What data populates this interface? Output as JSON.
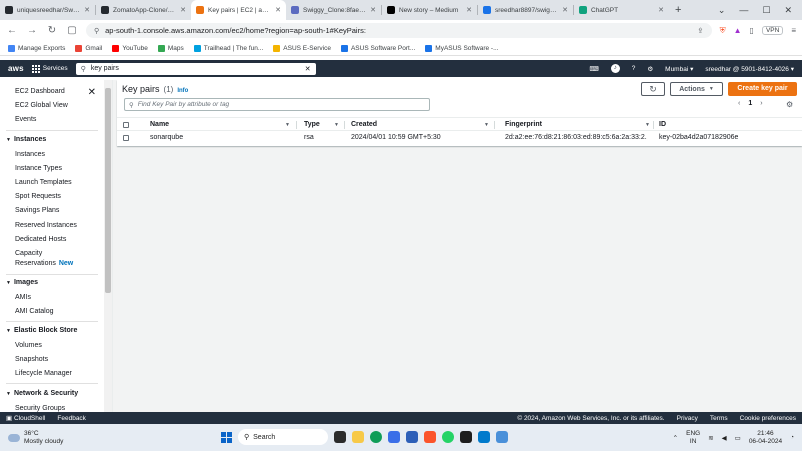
{
  "browser": {
    "tabs": [
      {
        "label": "uniquesreedhar/Swiggy_...",
        "color": "#24292f",
        "active": false
      },
      {
        "label": "ZomatoApp-Clone/Githu...",
        "color": "#24292f",
        "active": false
      },
      {
        "label": "Key pairs | EC2 | ap-s...",
        "color": "#ec7211",
        "active": true
      },
      {
        "label": "Swiggy_Clone:8fae6ef6-...",
        "color": "#5c6bc0",
        "active": false
      },
      {
        "label": "New story – Medium",
        "color": "#000000",
        "active": false
      },
      {
        "label": "sreedhar8897/swiggy Ta...",
        "color": "#1a73e8",
        "active": false
      },
      {
        "label": "ChatGPT",
        "color": "#10a37f",
        "active": false
      }
    ],
    "url": "ap-south-1.console.aws.amazon.com/ec2/home?region=ap-south-1#KeyPairs:",
    "vpn_label": "VPN",
    "bookmarks": [
      {
        "label": "Manage Exports",
        "color": "#4285f4"
      },
      {
        "label": "Gmail",
        "color": "#ea4335"
      },
      {
        "label": "YouTube",
        "color": "#ff0000"
      },
      {
        "label": "Maps",
        "color": "#34a853"
      },
      {
        "label": "Trailhead | The fun...",
        "color": "#00a1e0"
      },
      {
        "label": "ASUS E-Service",
        "color": "#f4b400"
      },
      {
        "label": "ASUS Software Port...",
        "color": "#1a73e8"
      },
      {
        "label": "MyASUS Software -...",
        "color": "#1a73e8"
      }
    ]
  },
  "aws_nav": {
    "logo": "aws",
    "services_label": "Services",
    "search_value": "key pairs",
    "region": "Mumbai ▾",
    "account": "sreedhar @ 5901-8412-4026 ▾"
  },
  "sidebar": {
    "dashboard": "EC2 Dashboard",
    "global_view": "EC2 Global View",
    "events": "Events",
    "instances_head": "Instances",
    "instances_items": [
      "Instances",
      "Instance Types",
      "Launch Templates",
      "Spot Requests",
      "Savings Plans",
      "Reserved Instances",
      "Dedicated Hosts",
      "Capacity"
    ],
    "capacity_reservations": "Reservations",
    "new_badge": "New",
    "images_head": "Images",
    "images_items": [
      "AMIs",
      "AMI Catalog"
    ],
    "ebs_head": "Elastic Block Store",
    "ebs_items": [
      "Volumes",
      "Snapshots",
      "Lifecycle Manager"
    ],
    "network_head": "Network & Security",
    "network_items": [
      "Security Groups"
    ]
  },
  "panel": {
    "title": "Key pairs",
    "count": "(1)",
    "info": "Info",
    "actions_label": "Actions",
    "create_label": "Create key pair",
    "filter_placeholder": "Find Key Pair by attribute or tag",
    "page": "1",
    "columns": [
      "Name",
      "Type",
      "Created",
      "Fingerprint",
      "ID"
    ],
    "rows": [
      {
        "name": "sonarqube",
        "type": "rsa",
        "created": "2024/04/01 10:59 GMT+5:30",
        "fingerprint": "2d:a2:ee:76:d8:21:86:03:ed:89:c5:6a:2a:33:2...",
        "id": "key-02ba4d2a07182906e"
      }
    ]
  },
  "footer": {
    "cloudshell": "CloudShell",
    "feedback": "Feedback",
    "copyright": "© 2024, Amazon Web Services, Inc. or its affiliates.",
    "privacy": "Privacy",
    "terms": "Terms",
    "cookies": "Cookie preferences"
  },
  "taskbar": {
    "temp": "36°C",
    "weather": "Mostly cloudy",
    "search_label": "Search",
    "lang1": "ENG",
    "lang2": "IN",
    "time": "21:46",
    "date": "06-04-2024"
  }
}
